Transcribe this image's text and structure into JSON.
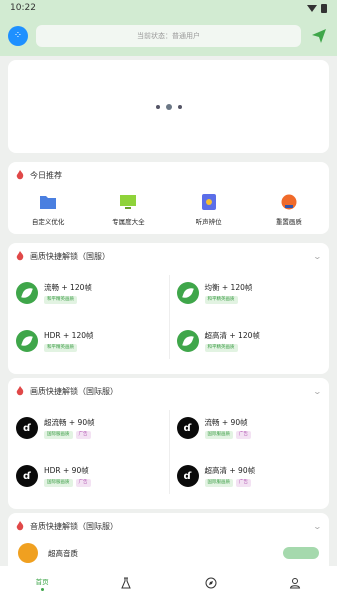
{
  "status_bar": {
    "time": "10:22"
  },
  "header": {
    "status_text": "当前状态：普通用户"
  },
  "today": {
    "title": "今日推荐",
    "items": [
      {
        "label": "自定义优化",
        "icon": "folder-icon",
        "color": "#4a7fe0"
      },
      {
        "label": "专属度大全",
        "icon": "monitor-icon",
        "color": "#8fd33a"
      },
      {
        "label": "听声辨位",
        "icon": "badge-icon",
        "color": "#5b6ee8"
      },
      {
        "label": "重置画质",
        "icon": "reset-icon",
        "color": "#f06a2a"
      }
    ]
  },
  "quick_cn": {
    "title": "画质快捷解锁（国服）",
    "items": [
      {
        "title": "流畅 + 120帧",
        "tags": [
          "和平精英画质"
        ]
      },
      {
        "title": "均衡 + 120帧",
        "tags": [
          "和平精英画质"
        ]
      },
      {
        "title": "HDR + 120帧",
        "tags": [
          "和平精英画质"
        ]
      },
      {
        "title": "超高清 + 120帧",
        "tags": [
          "和平精英画质"
        ]
      }
    ]
  },
  "quick_intl": {
    "title": "画质快捷解锁（国际服）",
    "items": [
      {
        "title": "超流畅 + 90帧",
        "tags": [
          "国际服画质",
          "广告"
        ]
      },
      {
        "title": "流畅 + 90帧",
        "tags": [
          "国际服画质",
          "广告"
        ]
      },
      {
        "title": "HDR + 90帧",
        "tags": [
          "国际服画质",
          "广告"
        ]
      },
      {
        "title": "超高清 + 90帧",
        "tags": [
          "国际服画质",
          "广告"
        ]
      }
    ]
  },
  "audio": {
    "title": "音质快捷解锁（国际服）",
    "item": "超高音质"
  },
  "tabbar": {
    "home_label": "首页"
  },
  "colors": {
    "accent": "#3fa64a",
    "header_bg": "#d2ebd2"
  }
}
